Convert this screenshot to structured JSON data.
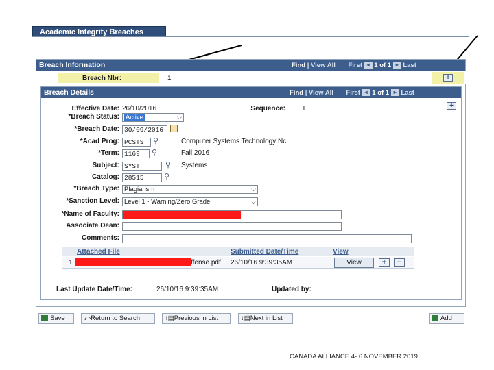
{
  "tab": {
    "title": "Academic Integrity Breaches"
  },
  "breach_info": {
    "title": "Breach Information",
    "find": "Find",
    "view_all": "View All",
    "first": "First",
    "first_arrow": "◂",
    "pager": "1 of 1",
    "last_arrow": "▸",
    "last": "Last",
    "nbr_label": "Breach Nbr:",
    "nbr_value": "1",
    "add_symbol": "+"
  },
  "breach_details": {
    "title": "Breach Details",
    "find": "Find",
    "view_all": "View All",
    "first": "First",
    "first_arrow": "◂",
    "pager": "1 of 1",
    "last_arrow": "▸",
    "last": "Last",
    "add_symbol": "+",
    "fields": {
      "effective_date_label": "Effective Date:",
      "effective_date_value": "26/10/2016",
      "sequence_label": "Sequence:",
      "sequence_value": "1",
      "status_label": "*Breach Status:",
      "status_value": "Active",
      "breach_date_label": "*Breach Date:",
      "breach_date_value": "30/09/2016",
      "acad_prog_label": "*Acad Prog:",
      "acad_prog_value": "PCSTS",
      "acad_prog_desc": "Computer Systems Technology Nc",
      "term_label": "*Term:",
      "term_value": "1169",
      "term_desc": "Fall 2016",
      "subject_label": "Subject:",
      "subject_value": "SYST",
      "subject_desc": "Systems",
      "catalog_label": "Catalog:",
      "catalog_value": "28515",
      "breach_type_label": "*Breach Type:",
      "breach_type_value": "Plagiarism",
      "sanction_label": "*Sanction Level:",
      "sanction_value": "Level 1 - Warning/Zero Grade",
      "faculty_label": "*Name of Faculty:",
      "dean_label": "Associate Dean:",
      "comments_label": "Comments:"
    },
    "grid": {
      "col_file": "Attached File",
      "col_date": "Submitted Date/Time",
      "col_view": "View",
      "row_index": "1",
      "row_file_tail": "ffense.pdf",
      "row_date": "26/10/16 9:39:35AM",
      "view_label": "View",
      "add_symbol": "+",
      "remove_symbol": "−"
    },
    "last_update_label": "Last Update Date/Time:",
    "last_update_value": "26/10/16 9:39:35AM",
    "updated_by_label": "Updated by:"
  },
  "toolbar": {
    "save": "Save",
    "return": "Return to Search",
    "previous": "Previous in List",
    "next": "Next in List",
    "add": "Add"
  },
  "footer": {
    "text": "CANADA ALLIANCE 4- 6 NOVEMBER 2019"
  },
  "colors": {
    "header_bar": "#3d5e8c",
    "highlight": "#f3f0a8",
    "redaction": "#ff1a1a"
  }
}
